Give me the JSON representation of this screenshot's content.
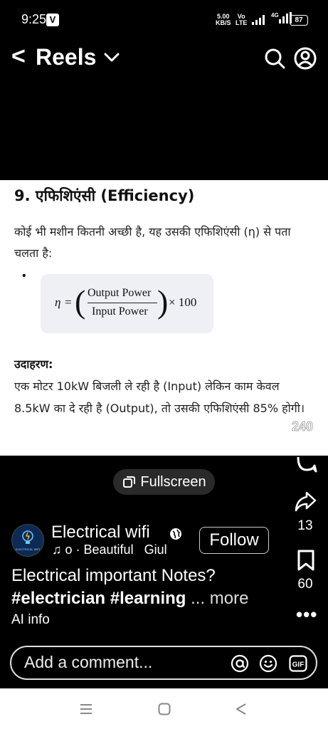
{
  "status_bar": {
    "time": "9:25",
    "notification_badge": "V",
    "net_speed_value": "5.00",
    "net_speed_unit": "KB/S",
    "volte_top": "Vo",
    "volte_bottom": "LTE",
    "signal2_label": "4G",
    "battery": "87"
  },
  "header": {
    "back_icon": "<",
    "title": "Reels"
  },
  "content": {
    "heading": "9. एफिशिएंसी (Efficiency)",
    "paragraph": "कोई भी मशीन कितनी अच्छी है, यह उसकी एफिशिएंसी (η) से पता चलता है:",
    "bullet": "•",
    "formula": {
      "lhs_symbol": "η",
      "equals": "=",
      "numerator": "Output Power",
      "denominator": "Input Power",
      "multiplier": "× 100"
    },
    "example_heading": "उदाहरण:",
    "example_text": "एक मोटर 10kW बिजली ले रही है (Input) लेकिन काम केवल 8.5kW का दे रही है (Output), तो उसकी एफिशिएंसी 85% होगी।",
    "page_number": "240"
  },
  "reel": {
    "fullscreen_label": "Fullscreen",
    "share_count": "13",
    "save_count": "60",
    "more_dots": "•••",
    "author_name": "Electrical wifi",
    "avatar_text": "ELECTRICAL WIFI",
    "follow_label": "Follow",
    "audio_note": "♫",
    "audio_text": "o · Beautiful   Giul",
    "caption_text": "Electrical important Notes?",
    "caption_tags": "#electrician #learning",
    "caption_more": " ... more",
    "ai_info": "AI info",
    "comment_placeholder": "Add a comment..."
  },
  "colors": {
    "background": "#000000",
    "card": "#ffffff",
    "formula_box": "#eef0f6",
    "pill": "#2a2a2a"
  }
}
